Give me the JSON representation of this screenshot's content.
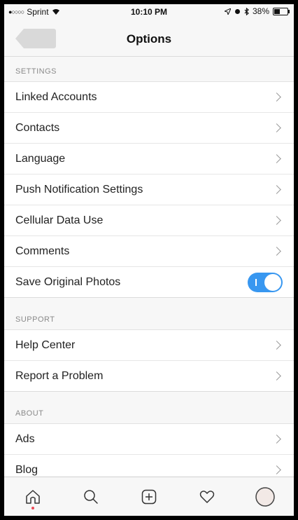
{
  "status_bar": {
    "carrier": "Sprint",
    "time": "10:10 PM",
    "battery": "38%"
  },
  "navbar": {
    "title": "Options"
  },
  "sections": [
    {
      "header": "SETTINGS",
      "items": [
        {
          "label": "Linked Accounts"
        },
        {
          "label": "Contacts"
        },
        {
          "label": "Language"
        },
        {
          "label": "Push Notification Settings"
        },
        {
          "label": "Cellular Data Use"
        },
        {
          "label": "Comments"
        },
        {
          "label": "Save Original Photos",
          "toggle": true,
          "on": true
        }
      ]
    },
    {
      "header": "SUPPORT",
      "items": [
        {
          "label": "Help Center"
        },
        {
          "label": "Report a Problem"
        }
      ]
    },
    {
      "header": "ABOUT",
      "items": [
        {
          "label": "Ads"
        },
        {
          "label": "Blog"
        }
      ]
    }
  ],
  "tabbar": {
    "items": [
      "home-icon",
      "search-icon",
      "add-icon",
      "heart-icon",
      "profile-icon"
    ]
  },
  "colors": {
    "accent": "#3897f0",
    "notification_dot": "#ed4956"
  }
}
